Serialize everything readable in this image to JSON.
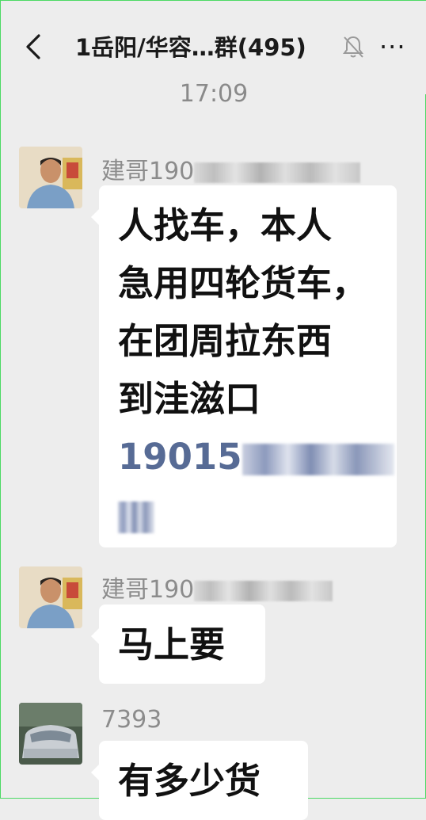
{
  "header": {
    "title": "1岳阳/华容…群(495)",
    "back_icon": "chevron-left-icon",
    "mute_icon": "bell-mute-icon",
    "more_icon": "more-dots-icon",
    "more_label": "···"
  },
  "timestamp": "17:09",
  "messages": [
    {
      "sender": "建哥190",
      "lines": [
        "人找车，本人",
        "急用四轮货车，",
        "在团周拉东西",
        "到洼滋口"
      ],
      "phone": "19015"
    },
    {
      "sender": "建哥190",
      "text": "马上要"
    },
    {
      "sender": "7393",
      "text": "有多少货"
    }
  ],
  "colors": {
    "background": "#ededed",
    "bubble": "#ffffff",
    "link": "#576b95",
    "name": "#8c8c8c"
  }
}
